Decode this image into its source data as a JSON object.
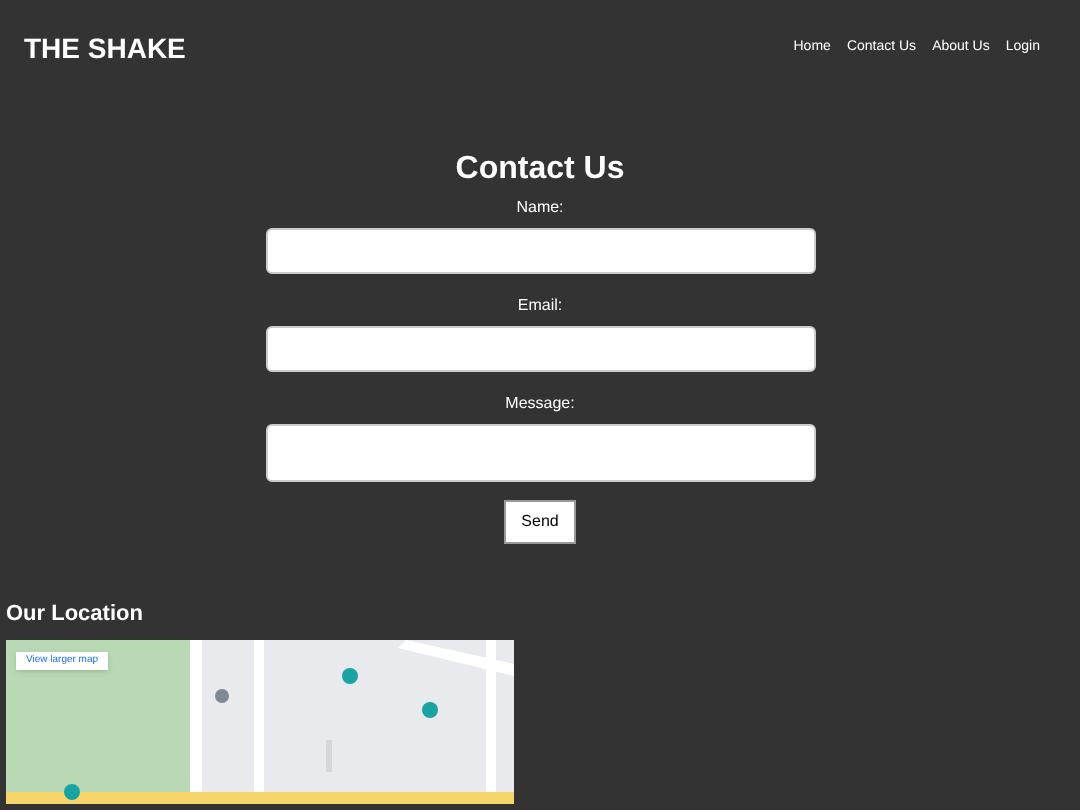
{
  "header": {
    "title": "THE SHAKE",
    "nav": [
      {
        "label": "Home"
      },
      {
        "label": "Contact Us"
      },
      {
        "label": "About Us"
      },
      {
        "label": "Login"
      }
    ]
  },
  "contact": {
    "heading": "Contact Us",
    "fields": [
      {
        "label": "Name:",
        "kind": "input"
      },
      {
        "label": "Email:",
        "kind": "input"
      },
      {
        "label": "Message:",
        "kind": "textarea"
      }
    ],
    "submit": "Send"
  },
  "location": {
    "heading": "Our Location",
    "map": {
      "kind": "picture",
      "button": "View larger map"
    }
  }
}
